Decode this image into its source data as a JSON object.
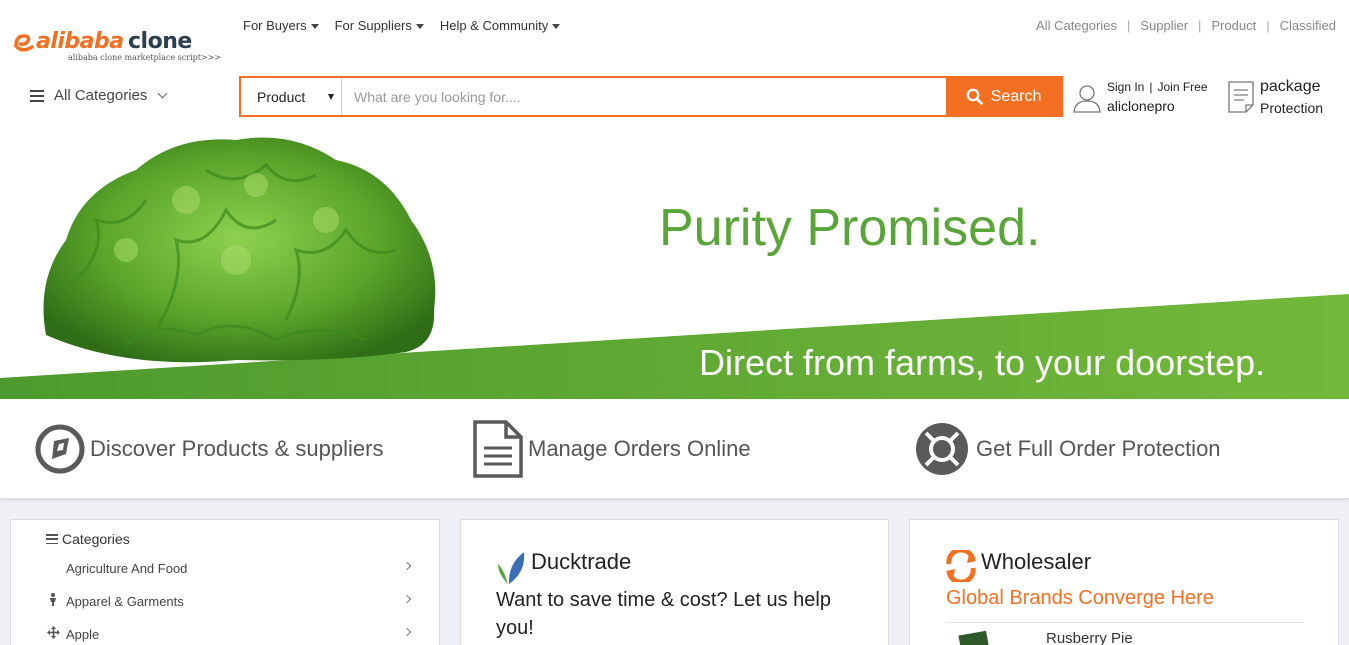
{
  "brand": {
    "logo_text": "alibabaclone",
    "logo_tagline": "alibaba clone marketplace script>>>"
  },
  "topnav": [
    {
      "label": "For Buyers"
    },
    {
      "label": "For Suppliers"
    },
    {
      "label": "Help & Community"
    }
  ],
  "toplinks": [
    {
      "label": "All Categories"
    },
    {
      "label": "Supplier"
    },
    {
      "label": "Product"
    },
    {
      "label": "Classified"
    }
  ],
  "all_categories_label": "All Categories",
  "search": {
    "type_selected": "Product",
    "placeholder": "What are you looking for....",
    "button_label": "Search"
  },
  "account": {
    "sign_in": "Sign In",
    "separator": "|",
    "join": "Join Free",
    "username": "aliclonepro"
  },
  "package": {
    "line1": "package",
    "line2": "Protection"
  },
  "banner": {
    "headline": "Purity Promised.",
    "tagline": "Direct from farms, to your doorstep."
  },
  "features": [
    {
      "label": "Discover Products & suppliers",
      "icon": "compass-icon"
    },
    {
      "label": "Manage Orders Online",
      "icon": "document-icon"
    },
    {
      "label": "Get Full Order Protection",
      "icon": "lifebuoy-icon"
    }
  ],
  "categories": {
    "heading": "Categories",
    "items": [
      {
        "label": "Agriculture And Food",
        "icon": ""
      },
      {
        "label": "Apparel & Garments",
        "icon": "person-icon"
      },
      {
        "label": "Apple",
        "icon": "move-icon"
      }
    ]
  },
  "ducktrade": {
    "title": "Ducktrade",
    "text": "Want to save time & cost? Let us help you!"
  },
  "wholesaler": {
    "title": "Wholesaler",
    "subtitle": "Global Brands Converge Here",
    "first_item": "Rusberry Pie"
  },
  "colors": {
    "accent": "#f37022",
    "brand_green": "#5aa53a",
    "banner_green": "#6cb33e"
  }
}
